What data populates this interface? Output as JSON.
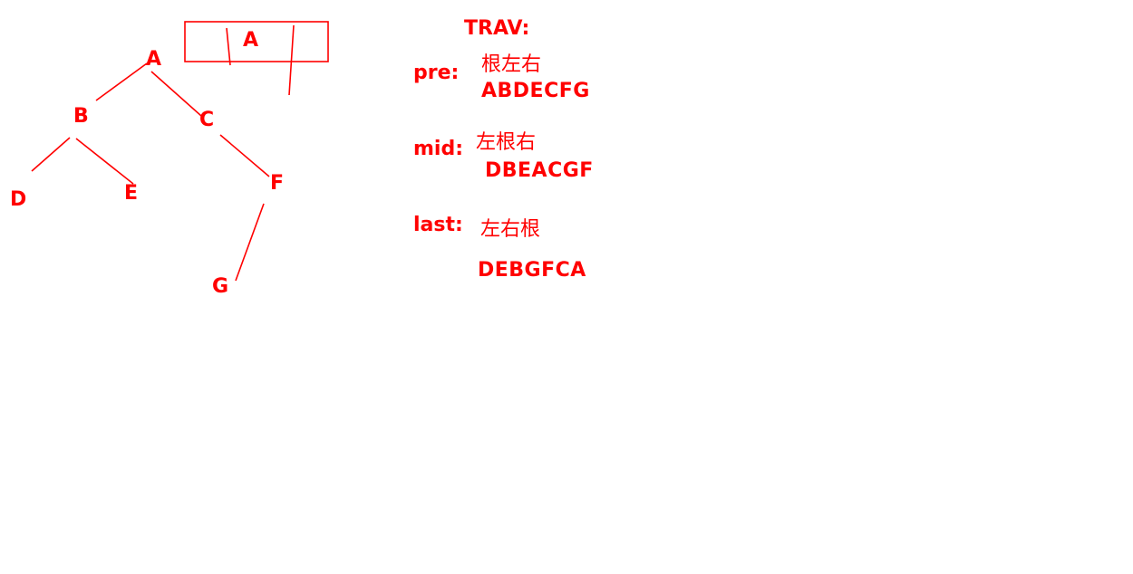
{
  "tree": {
    "nodes": [
      "A",
      "B",
      "C",
      "D",
      "E",
      "F",
      "G"
    ],
    "box_label": "A"
  },
  "traversal": {
    "title": "TRAV:",
    "pre": {
      "label": "pre:",
      "order": "根左右",
      "sequence": "ABDECFG"
    },
    "mid": {
      "label": "mid:",
      "order": "左根右",
      "sequence": "DBEACGF"
    },
    "last": {
      "label": "last:",
      "order": "左右根",
      "sequence": "DEBGFCA"
    }
  },
  "colors": {
    "ink": "#ff0000",
    "background": "#ffffff"
  }
}
